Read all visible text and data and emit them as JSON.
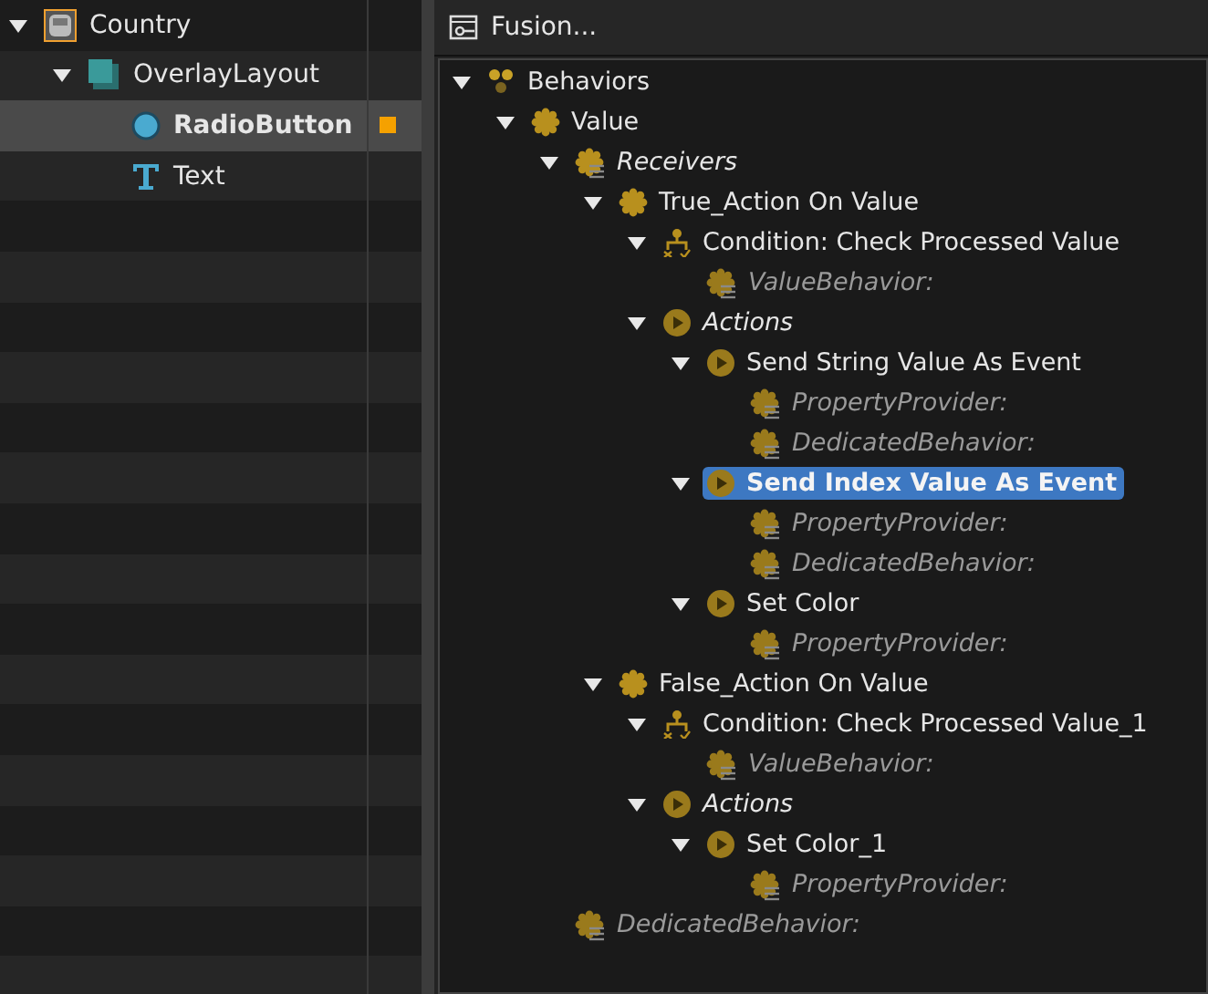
{
  "hierarchy": {
    "items": [
      {
        "label": "Country",
        "kind": "window",
        "expanded": true,
        "selected": false,
        "flagged": false,
        "children": [
          {
            "label": "OverlayLayout",
            "kind": "layout",
            "expanded": true,
            "selected": false,
            "flagged": false,
            "children": [
              {
                "label": "RadioButton",
                "kind": "radio",
                "selected": true,
                "flagged": true
              },
              {
                "label": "Text",
                "kind": "text",
                "selected": false,
                "flagged": false
              }
            ]
          }
        ]
      }
    ]
  },
  "behaviors_panel": {
    "title": "Fusion...",
    "tree": [
      {
        "label": "Behaviors",
        "kind": "behaviors",
        "expanded": true,
        "selected": false,
        "children": [
          {
            "label": "Value",
            "kind": "behavior",
            "expanded": true,
            "selected": false,
            "children": [
              {
                "label": "Receivers",
                "kind": "receivers",
                "expanded": true,
                "selected": false,
                "children": [
                  {
                    "label": "True_Action On Value",
                    "kind": "behavior",
                    "expanded": true,
                    "selected": false,
                    "children": [
                      {
                        "label": "Condition: Check Processed Value",
                        "kind": "condition",
                        "expanded": true,
                        "selected": false,
                        "children": [
                          {
                            "label": "ValueBehavior:",
                            "kind": "property",
                            "selected": false
                          }
                        ]
                      },
                      {
                        "label": "Actions",
                        "kind": "actions",
                        "expanded": true,
                        "selected": false,
                        "children": [
                          {
                            "label": "Send String Value As Event",
                            "kind": "action",
                            "expanded": true,
                            "selected": false,
                            "children": [
                              {
                                "label": "PropertyProvider:",
                                "kind": "property",
                                "selected": false
                              },
                              {
                                "label": "DedicatedBehavior:",
                                "kind": "property",
                                "selected": false
                              }
                            ]
                          },
                          {
                            "label": "Send Index Value As Event",
                            "kind": "action",
                            "expanded": true,
                            "selected": true,
                            "children": [
                              {
                                "label": "PropertyProvider:",
                                "kind": "property",
                                "selected": false
                              },
                              {
                                "label": "DedicatedBehavior:",
                                "kind": "property",
                                "selected": false
                              }
                            ]
                          },
                          {
                            "label": "Set Color",
                            "kind": "action",
                            "expanded": true,
                            "selected": false,
                            "children": [
                              {
                                "label": "PropertyProvider:",
                                "kind": "property",
                                "selected": false
                              }
                            ]
                          }
                        ]
                      }
                    ]
                  },
                  {
                    "label": "False_Action On Value",
                    "kind": "behavior",
                    "expanded": true,
                    "selected": false,
                    "children": [
                      {
                        "label": "Condition: Check Processed Value_1",
                        "kind": "condition",
                        "expanded": true,
                        "selected": false,
                        "children": [
                          {
                            "label": "ValueBehavior:",
                            "kind": "property",
                            "selected": false
                          }
                        ]
                      },
                      {
                        "label": "Actions",
                        "kind": "actions",
                        "expanded": true,
                        "selected": false,
                        "children": [
                          {
                            "label": "Set Color_1",
                            "kind": "action",
                            "expanded": true,
                            "selected": false,
                            "children": [
                              {
                                "label": "PropertyProvider:",
                                "kind": "property",
                                "selected": false
                              }
                            ]
                          }
                        ]
                      }
                    ]
                  }
                ]
              },
              {
                "label": "DedicatedBehavior:",
                "kind": "property",
                "selected": false
              }
            ]
          }
        ]
      }
    ]
  }
}
